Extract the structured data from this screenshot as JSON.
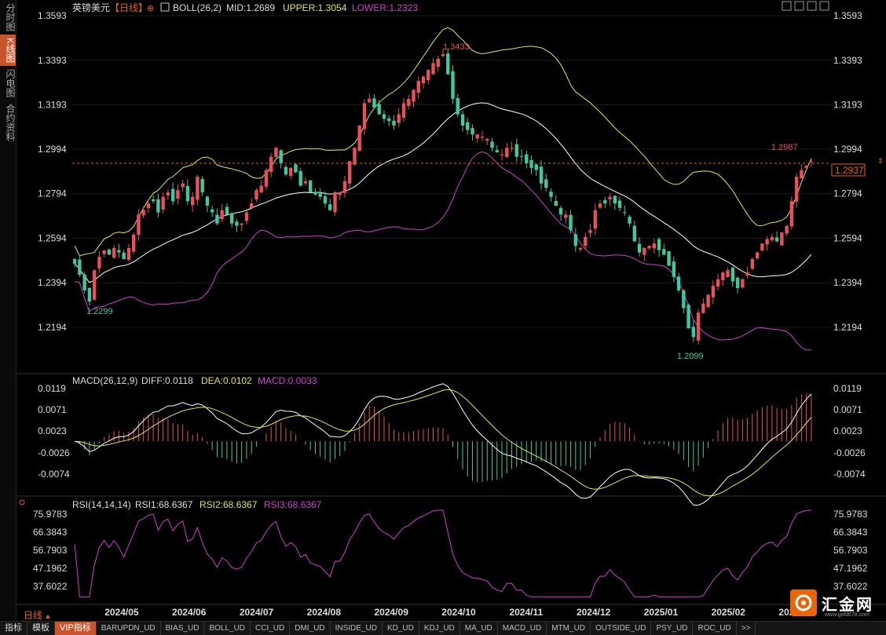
{
  "sidebar": {
    "items": [
      {
        "label": "分时图",
        "active": false
      },
      {
        "label": "K线图",
        "active": true
      },
      {
        "label": "闪电图",
        "active": false
      },
      {
        "label": "合约资料",
        "active": false
      }
    ]
  },
  "header": {
    "symbol": "英镑美元",
    "period": "【日线】",
    "boll_label": "BOLL(26,2)",
    "mid": "MID:1.2689",
    "upper": "UPPER:1.3054",
    "lower": "LOWER:1.2323"
  },
  "macd_header": {
    "label": "MACD(26,12,9)",
    "diff": "DIFF:0.0118",
    "dea": "DEA:0.0102",
    "macd": "MACD:0.0033"
  },
  "rsi_header": {
    "label": "RSI(14,14,14)",
    "rsi1": "RSI1:68.6367",
    "rsi2": "RSI2:68.6367",
    "rsi3": "RSI3:68.6367"
  },
  "period_selector": "日线",
  "current_price": "1.2937",
  "annotations": {
    "high1": "1.3433",
    "low1": "1.2299",
    "low2": "1.2099",
    "high2": "1.2987"
  },
  "bottom_tabs": [
    "指标",
    "模板",
    "VIP指标",
    "BARUPDN_UD",
    "BIAS_UD",
    "BOLL_UD",
    "CCI_UD",
    "DMI_UD",
    "INSIDE_UD",
    "KD_UD",
    "KDJ_UD",
    "MA_UD",
    "MACD_UD",
    "MTM_UD",
    "OUTSIDE_UD",
    "PSY_UD",
    "ROC_UD",
    ">>"
  ],
  "logo": {
    "name": "汇金网",
    "url": "www.gold678.com"
  },
  "colors": {
    "up": "#e8505b",
    "down": "#3fc9a0",
    "upper_band": "#e6e64a",
    "mid_band": "#ffffff",
    "lower_band": "#d23cd2",
    "price_line": "#e8650a",
    "rsi": "#d23cd2",
    "dea": "#e6e64a",
    "diff": "#ffffff"
  },
  "chart_data": [
    {
      "type": "candlestick",
      "title": "英镑美元 日线 BOLL(26,2)",
      "y_ticks": [
        "1.3593",
        "1.3393",
        "1.3193",
        "1.2994",
        "1.2794",
        "1.2594",
        "1.2394",
        "1.2194"
      ],
      "ylim": [
        1.209,
        1.3593
      ],
      "x_ticks": [
        "2024/05",
        "2024/06",
        "2024/07",
        "2024/08",
        "2024/09",
        "2024/10",
        "2024/11",
        "2024/12",
        "2025/01",
        "2025/02",
        "2025/03"
      ],
      "series": [
        {
          "name": "close",
          "values": [
            1.248,
            1.243,
            1.236,
            1.231,
            1.245,
            1.251,
            1.254,
            1.252,
            1.255,
            1.253,
            1.25,
            1.255,
            1.261,
            1.27,
            1.272,
            1.275,
            1.276,
            1.271,
            1.278,
            1.28,
            1.276,
            1.281,
            1.284,
            1.276,
            1.278,
            1.287,
            1.28,
            1.274,
            1.271,
            1.266,
            1.272,
            1.27,
            1.266,
            1.265,
            1.266,
            1.271,
            1.275,
            1.281,
            1.283,
            1.29,
            1.296,
            1.3,
            1.293,
            1.288,
            1.291,
            1.289,
            1.283,
            1.285,
            1.28,
            1.279,
            1.278,
            1.275,
            1.272,
            1.28,
            1.28,
            1.285,
            1.294,
            1.3,
            1.31,
            1.32,
            1.322,
            1.318,
            1.315,
            1.313,
            1.312,
            1.31,
            1.315,
            1.32,
            1.322,
            1.326,
            1.33,
            1.332,
            1.335,
            1.338,
            1.34,
            1.342,
            1.333,
            1.322,
            1.315,
            1.31,
            1.308,
            1.306,
            1.306,
            1.305,
            1.304,
            1.3,
            1.298,
            1.297,
            1.3,
            1.3,
            1.296,
            1.296,
            1.293,
            1.291,
            1.29,
            1.284,
            1.282,
            1.278,
            1.274,
            1.27,
            1.27,
            1.263,
            1.256,
            1.255,
            1.26,
            1.263,
            1.272,
            1.275,
            1.275,
            1.278,
            1.275,
            1.273,
            1.271,
            1.266,
            1.258,
            1.253,
            1.255,
            1.256,
            1.257,
            1.254,
            1.252,
            1.247,
            1.242,
            1.236,
            1.228,
            1.219,
            1.215,
            1.226,
            1.23,
            1.234,
            1.238,
            1.241,
            1.244,
            1.245,
            1.24,
            1.237,
            1.241,
            1.244,
            1.25,
            1.253,
            1.257,
            1.259,
            1.26,
            1.258,
            1.262,
            1.265,
            1.276,
            1.287,
            1.29,
            1.292,
            1.294
          ]
        }
      ],
      "bands": {
        "upper_last": 1.3054,
        "mid_last": 1.2689,
        "lower_last": 1.2323
      }
    },
    {
      "type": "bar",
      "title": "MACD(26,12,9)",
      "y_ticks": [
        "0.0119",
        "0.0071",
        "0.0023",
        "-0.0026",
        "-0.0074"
      ],
      "ylim": [
        -0.01,
        0.013
      ],
      "series": [
        {
          "name": "DIFF",
          "last": 0.0118
        },
        {
          "name": "DEA",
          "last": 0.0102
        },
        {
          "name": "MACD",
          "last": 0.0033
        }
      ]
    },
    {
      "type": "line",
      "title": "RSI(14,14,14)",
      "y_ticks": [
        "75.9783",
        "66.3843",
        "56.7903",
        "47.1962",
        "37.6022"
      ],
      "ylim": [
        30,
        80
      ],
      "series": [
        {
          "name": "RSI1",
          "last": 68.6367
        },
        {
          "name": "RSI2",
          "last": 68.6367
        },
        {
          "name": "RSI3",
          "last": 68.6367
        }
      ]
    }
  ]
}
